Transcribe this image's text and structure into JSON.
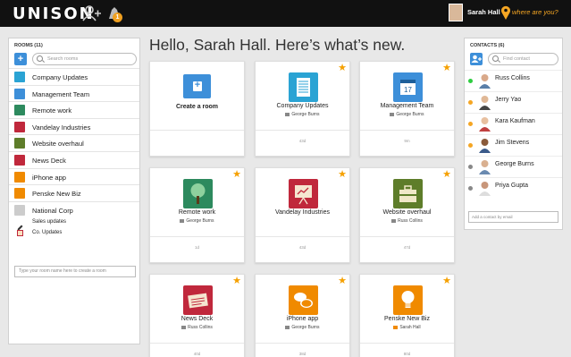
{
  "app": {
    "logo": "UNISON"
  },
  "topbar": {
    "notification_count": "1",
    "user_name": "Sarah Hall",
    "where_link": "where are you?",
    "colors": {
      "accent": "#f5a623",
      "bar": "#111111"
    }
  },
  "rooms_panel": {
    "title": "ROOMS (11)",
    "search_placeholder": "Search rooms",
    "items": [
      {
        "label": "Company Updates",
        "icon": "newspaper-icon",
        "color": "#2aa3d4"
      },
      {
        "label": "Management Team",
        "icon": "calendar-icon",
        "color": "#3d8fd9"
      },
      {
        "label": "Remote work",
        "icon": "tree-icon",
        "color": "#2d8a5e"
      },
      {
        "label": "Vandelay Industries",
        "icon": "presentation-icon",
        "color": "#c0283c"
      },
      {
        "label": "Website overhaul",
        "icon": "toolbox-icon",
        "color": "#5e7d2a"
      },
      {
        "label": "News Deck",
        "icon": "news-icon",
        "color": "#c0283c"
      },
      {
        "label": "iPhone app",
        "icon": "chat-bubbles-icon",
        "color": "#f08a00"
      },
      {
        "label": "Penske New Biz",
        "icon": "lightbulb-icon",
        "color": "#f08a00"
      },
      {
        "label": "National Corp",
        "icon": "cube-icon",
        "color": "#cccccc"
      }
    ],
    "sub_items": [
      {
        "label": "Sales updates",
        "icon": "pencil-icon"
      },
      {
        "label": "Co. Updates",
        "icon": "newspaper-icon"
      }
    ],
    "new_room_placeholder": "Type your room name here to create a room"
  },
  "main": {
    "headline": "Hello, Sarah Hall. Here’s what’s new.",
    "create_card": {
      "label": "Create a room"
    },
    "cards": [
      {
        "title": "Company Updates",
        "owner": "George Burns",
        "footer": "43d",
        "icon": "newspaper-icon",
        "color": "#2aa3d4"
      },
      {
        "title": "Management Team",
        "owner": "George Burns",
        "footer": "9m",
        "icon": "calendar-icon",
        "color": "#3d8fd9"
      },
      {
        "title": "Remote work",
        "owner": "George Burns",
        "footer": "1d",
        "icon": "tree-icon",
        "color": "#2d8a5e"
      },
      {
        "title": "Vandelay Industries",
        "owner": "",
        "footer": "43d",
        "icon": "presentation-icon",
        "color": "#c0283c"
      },
      {
        "title": "Website overhaul",
        "owner": "Russ Collins",
        "footer": "47d",
        "icon": "toolbox-icon",
        "color": "#5e7d2a"
      },
      {
        "title": "News Deck",
        "owner": "Russ Collins",
        "footer": "40d",
        "icon": "news-icon",
        "color": "#c0283c"
      },
      {
        "title": "iPhone app",
        "owner": "George Burns",
        "footer": "38d",
        "icon": "chat-bubbles-icon",
        "color": "#f08a00"
      },
      {
        "title": "Penske New Biz",
        "owner": "Sarah Hall",
        "footer": "80d",
        "icon": "lightbulb-icon",
        "color": "#f08a00"
      }
    ]
  },
  "contacts_panel": {
    "title": "CONTACTS (6)",
    "search_placeholder": "Find contact",
    "contacts": [
      {
        "name": "Russ Collins",
        "status_color": "#2ecc40"
      },
      {
        "name": "Jerry Yao",
        "status_color": "#f5a623"
      },
      {
        "name": "Kara Kaufman",
        "status_color": "#f5a623"
      },
      {
        "name": "Jim Stevens",
        "status_color": "#f5a623"
      },
      {
        "name": "George Burns",
        "status_color": "#888888"
      },
      {
        "name": "Priya Gupta",
        "status_color": "#888888"
      }
    ],
    "add_contact_placeholder": "Add a contact by email"
  }
}
